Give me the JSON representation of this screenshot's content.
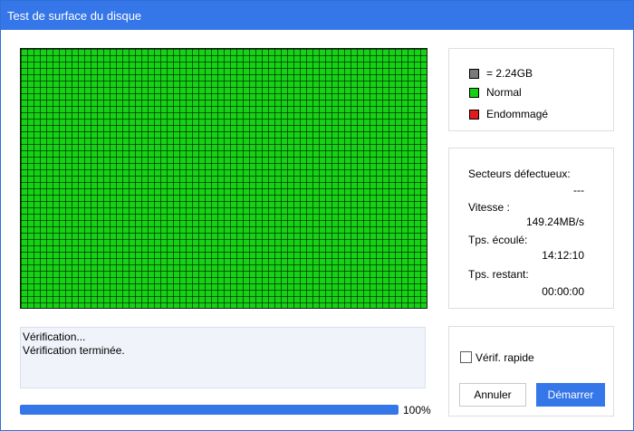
{
  "window": {
    "title": "Test de surface du disque"
  },
  "legend": {
    "items": [
      {
        "label": "= 2.24GB",
        "color": "#7a7a7a"
      },
      {
        "label": "Normal",
        "color": "#15d215"
      },
      {
        "label": "Endommagé",
        "color": "#e31b1b"
      }
    ]
  },
  "stats": {
    "bad_sectors_label": "Secteurs défectueux:",
    "bad_sectors_value": "---",
    "speed_label": "Vitesse :",
    "speed_value": "149.24MB/s",
    "elapsed_label": "Tps. écoulé:",
    "elapsed_value": "14:12:10",
    "remaining_label": "Tps. restant:",
    "remaining_value": "00:00:00"
  },
  "log": {
    "lines": [
      "Vérification...",
      "Vérification terminée."
    ]
  },
  "progress": {
    "value": 100,
    "label": "100%"
  },
  "options": {
    "quick_check_label": "Vérif. rapide",
    "quick_check_checked": false
  },
  "buttons": {
    "cancel": "Annuler",
    "start": "Démarrer"
  },
  "colors": {
    "accent": "#3576e8",
    "normal": "#15d215",
    "damaged": "#e31b1b"
  }
}
